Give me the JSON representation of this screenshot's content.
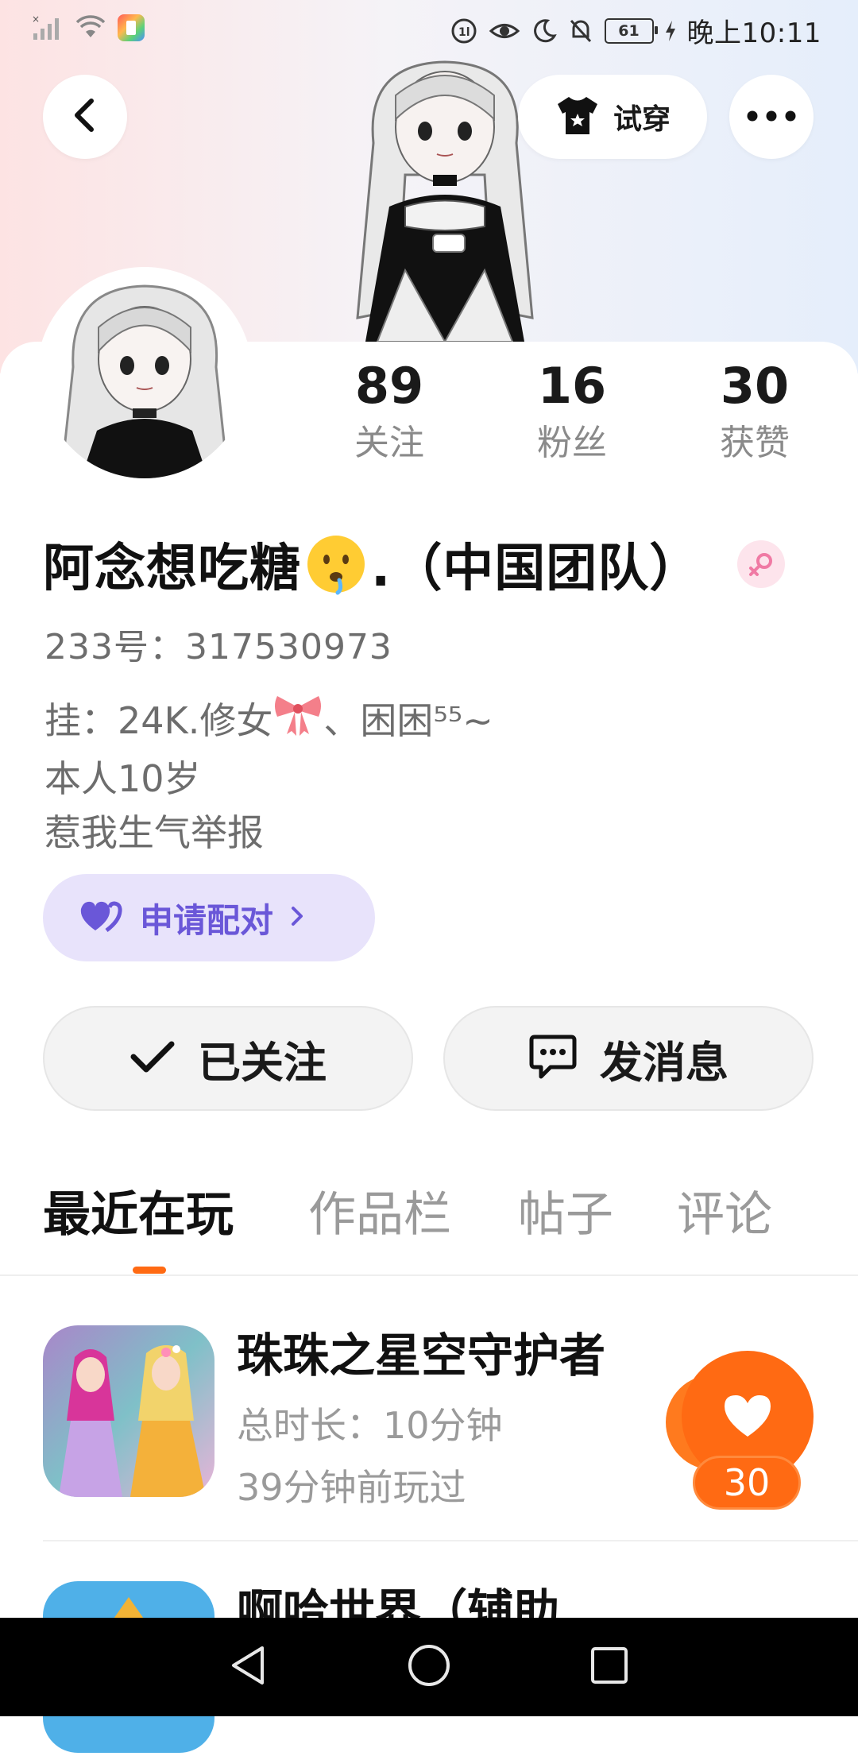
{
  "status_bar": {
    "time": "晚上10:11",
    "battery": "61"
  },
  "header": {
    "try_on_label": "试穿"
  },
  "stats": [
    {
      "value": "89",
      "label": "关注"
    },
    {
      "value": "16",
      "label": "粉丝"
    },
    {
      "value": "30",
      "label": "获赞"
    }
  ],
  "profile": {
    "name_prefix": "阿念想吃糖",
    "name_suffix": ".（中国团队）",
    "uid": "233号：317530973",
    "bio": {
      "line1_a": "挂：24K.修女",
      "line1_b": "、困困⁵⁵~",
      "line2": "本人10岁",
      "line3": "惹我生气举报"
    }
  },
  "pair_button": {
    "label": "申请配对"
  },
  "actions": {
    "follow_label": "已关注",
    "message_label": "发消息"
  },
  "tabs": [
    {
      "label": "最近在玩",
      "active": true
    },
    {
      "label": "作品栏",
      "active": false
    },
    {
      "label": "帖子",
      "active": false
    },
    {
      "label": "评论",
      "active": false
    }
  ],
  "games": [
    {
      "title": "珠珠之星空守护者",
      "total_time": "总时长：10分钟",
      "last_played": "39分钟前玩过",
      "likes": "30"
    },
    {
      "title": "啊哈世界（辅助..."
    }
  ],
  "colors": {
    "accent": "#ff6a13",
    "pair_bg": "#e8e3fb",
    "pair_text": "#6a57d8",
    "gender_badge": "#fde4ec"
  }
}
